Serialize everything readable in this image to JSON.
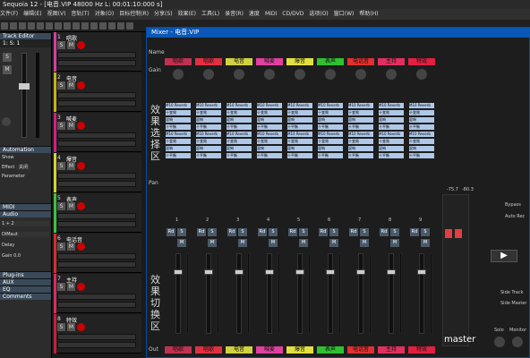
{
  "window": {
    "title": "Sequoia 12 - [电音.VIP    48000 Hz L: 00:01:10:000 s]"
  },
  "menu": [
    "文件(F)",
    "编辑(E)",
    "视图(V)",
    "音轨(T)",
    "对象(O)",
    "目标控制(R)",
    "分享(S)",
    "效果(E)",
    "工具(L)",
    "录音(R)",
    "速度",
    "MIDI",
    "CD/DVD",
    "选项(O)",
    "窗口(W)",
    "帮助(H)"
  ],
  "track_editor": {
    "title": "Track Editor",
    "track": "1: S: 1",
    "sections": [
      "Automation",
      "MIDI",
      "Audio",
      "Plug-ins",
      "AUX",
      "EQ",
      "Comments"
    ],
    "automation_field": "关闭",
    "params": [
      "Show",
      "Effect",
      "Parameter"
    ],
    "audio": {
      "io": "1 + 2",
      "mode": "DiMaut",
      "delay": "Delay",
      "gain": "0.0",
      "gain_label": "Gain"
    }
  },
  "tracks": [
    {
      "num": "1",
      "name": "唱歌",
      "color": "#d040a0"
    },
    {
      "num": "2",
      "name": "电音",
      "color": "#c0b020"
    },
    {
      "num": "3",
      "name": "喊麦",
      "color": "#d02080"
    },
    {
      "num": "4",
      "name": "爆音",
      "color": "#d0d040"
    },
    {
      "num": "5",
      "name": "表声",
      "color": "#40c040"
    },
    {
      "num": "6",
      "name": "电话音",
      "color": "#d03030"
    },
    {
      "num": "7",
      "name": "主持",
      "color": "#d03060"
    },
    {
      "num": "8",
      "name": "特效",
      "color": "#c02040"
    }
  ],
  "mixer": {
    "title": "Mixer - 电音.VIP",
    "labels": {
      "name": "Name",
      "gain": "Gain",
      "pan": "Pan",
      "out": "Out"
    },
    "channels": [
      {
        "name": "唱歌",
        "color": "#c03050",
        "num": "1"
      },
      {
        "name": "唱歌",
        "color": "#e03040",
        "num": "2"
      },
      {
        "name": "电音",
        "color": "#d0d040",
        "num": "3"
      },
      {
        "name": "喊麦",
        "color": "#e040a0",
        "num": "4"
      },
      {
        "name": "爆音",
        "color": "#e0e040",
        "num": "5"
      },
      {
        "name": "表声",
        "color": "#30c030",
        "num": "6"
      },
      {
        "name": "电话音",
        "color": "#e03030",
        "num": "7"
      },
      {
        "name": "主持",
        "color": "#e03060",
        "num": "8"
      },
      {
        "name": "特效",
        "color": "#e02040",
        "num": "9"
      }
    ],
    "fx_labels": [
      "M10 Reverb",
      "十变效",
      "混响",
      "十平衡"
    ],
    "vertical_text_1": "效果选择区",
    "vertical_text_2": "效果切换区",
    "master": "master",
    "master_values": [
      "-75.7",
      "-80.3"
    ],
    "right_buttons": [
      "Bypass",
      "Auto Rec",
      "Side Track",
      "Side Master"
    ],
    "solo": "Solo",
    "monitor": "Monitor"
  }
}
